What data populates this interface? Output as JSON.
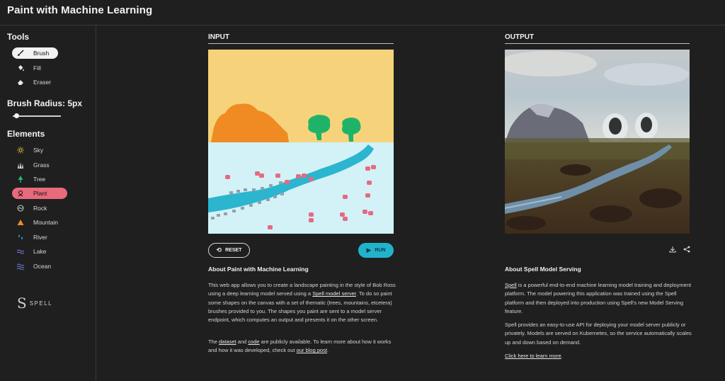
{
  "header": {
    "title": "Paint with Machine Learning"
  },
  "sidebar": {
    "tools_title": "Tools",
    "tools": [
      {
        "label": "Brush",
        "icon": "brush-icon",
        "active": true
      },
      {
        "label": "Fill",
        "icon": "paint-bucket-icon",
        "active": false
      },
      {
        "label": "Eraser",
        "icon": "eraser-icon",
        "active": false
      }
    ],
    "brush_radius_label": "Brush Radius: 5px",
    "elements_title": "Elements",
    "elements": [
      {
        "label": "Sky",
        "icon": "sun-icon",
        "color": "#f5c842"
      },
      {
        "label": "Grass",
        "icon": "grass-icon",
        "color": "#cfd8e6"
      },
      {
        "label": "Tree",
        "icon": "tree-icon",
        "color": "#29b36b"
      },
      {
        "label": "Plant",
        "icon": "plant-icon",
        "color": "#e86a7d",
        "active": true
      },
      {
        "label": "Rock",
        "icon": "rock-icon",
        "color": "#cfcfcf"
      },
      {
        "label": "Mountain",
        "icon": "mountain-icon",
        "color": "#f08a24"
      },
      {
        "label": "River",
        "icon": "river-icon",
        "color": "#22b3cc"
      },
      {
        "label": "Lake",
        "icon": "lake-icon",
        "color": "#9b6fe0"
      },
      {
        "label": "Ocean",
        "icon": "ocean-icon",
        "color": "#6f7fe0"
      }
    ],
    "logo_text": "SPELL"
  },
  "input_panel": {
    "label": "INPUT",
    "reset_label": "RESET",
    "run_label": "RUN",
    "colors": {
      "sky": "#f6d37a",
      "water": "#d2f2f7",
      "mountain": "#ef8b22",
      "tree": "#1fb36a",
      "river": "#2bb5cf",
      "plant": "#e56a80",
      "rock": "#9a9fa8"
    },
    "about_title": "About Paint with Machine Learning",
    "about_p1_a": "This web app allows you to create a landscape painting in the style of Bob Ross using a deep learning model served using a ",
    "about_p1_link": "Spell model server",
    "about_p1_b": ". To do so paint some shapes on the canvas with a set of thematic (trees, mountains, etcetera) brushes provided to you. The shapes you paint are sent to a model server endpoint, which computes an output and presents it on the other screen.",
    "about_p2_a": "The ",
    "about_p2_link1": "dataset",
    "about_p2_b": " and ",
    "about_p2_link2": "code",
    "about_p2_c": " are publicly available. To learn more about how it works and how it was developed, check out ",
    "about_p2_link3": "our blog post",
    "about_p2_d": "."
  },
  "output_panel": {
    "label": "OUTPUT",
    "download_icon": "download-icon",
    "share_icon": "share-icon",
    "about_title": "About Spell Model Serving",
    "about_p1_link": "Spell",
    "about_p1_b": " is a powerful end-to-end machine learning model training and deployment platform. The model powering this application was trained using the Spell platform and then deployed into production using Spell's new Model Serving feature.",
    "about_p2": "Spell provides an easy-to-use API for deploying your model server publicly or privately. Models are served on Kubernetes, so the service automatically scales up and down based on demand.",
    "learn_more": "Click here to learn more",
    "learn_more_tail": "."
  }
}
